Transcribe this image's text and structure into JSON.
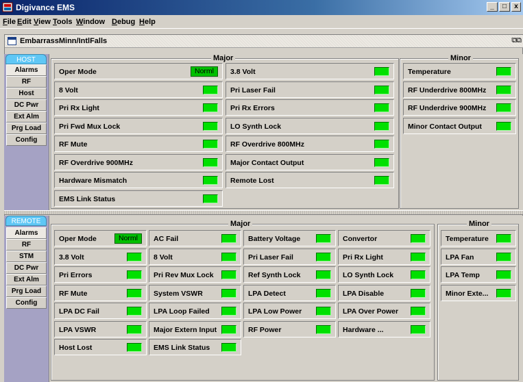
{
  "window": {
    "title": "Digivance EMS",
    "controls": {
      "minimize": "_",
      "maximize": "□",
      "close": "x"
    }
  },
  "menu": [
    "File",
    "Edit",
    "View",
    "Tools",
    "Window",
    "Debug",
    "Help"
  ],
  "document": {
    "title": "EmbarrassMinn/IntlFalls",
    "restore_glyph": "⧉⧉"
  },
  "host": {
    "side_label": "HOST",
    "tabs": [
      "Alarms",
      "RF",
      "Host",
      "DC Pwr",
      "Ext Alm",
      "Prg Load",
      "Config"
    ],
    "selected_tab": "Alarms",
    "major_label": "Major",
    "minor_label": "Minor",
    "major": [
      {
        "label": "Oper Mode",
        "mode": "Norml"
      },
      {
        "label": "3.8 Volt",
        "status": "ok"
      },
      {
        "label": "8 Volt",
        "status": "ok"
      },
      {
        "label": "Pri Laser Fail",
        "status": "ok"
      },
      {
        "label": "Pri Rx Light",
        "status": "ok"
      },
      {
        "label": "Pri Rx Errors",
        "status": "ok"
      },
      {
        "label": "Pri Fwd Mux Lock",
        "status": "ok"
      },
      {
        "label": "LO Synth Lock",
        "status": "ok"
      },
      {
        "label": "RF Mute",
        "status": "ok"
      },
      {
        "label": "RF Overdrive 800MHz",
        "status": "ok"
      },
      {
        "label": "RF Overdrive 900MHz",
        "status": "ok"
      },
      {
        "label": "Major Contact Output",
        "status": "ok"
      },
      {
        "label": "Hardware Mismatch",
        "status": "ok"
      },
      {
        "label": "Remote Lost",
        "status": "ok"
      },
      {
        "label": "EMS Link Status",
        "status": "ok"
      }
    ],
    "minor": [
      {
        "label": "Temperature",
        "status": "ok"
      },
      {
        "label": "RF Underdrive 800MHz",
        "status": "ok"
      },
      {
        "label": "RF Underdrive 900MHz",
        "status": "ok"
      },
      {
        "label": "Minor Contact Output",
        "status": "ok"
      }
    ]
  },
  "remote": {
    "side_label": "REMOTE",
    "tabs": [
      "Alarms",
      "RF",
      "STM",
      "DC Pwr",
      "Ext Alm",
      "Prg Load",
      "Config"
    ],
    "selected_tab": "Alarms",
    "major_label": "Major",
    "minor_label": "Minor",
    "major": [
      {
        "label": "Oper Mode",
        "mode": "Norml"
      },
      {
        "label": "AC Fail",
        "status": "ok"
      },
      {
        "label": "Battery Voltage",
        "status": "ok"
      },
      {
        "label": "Convertor",
        "status": "ok"
      },
      {
        "label": "3.8 Volt",
        "status": "ok"
      },
      {
        "label": "8 Volt",
        "status": "ok"
      },
      {
        "label": "Pri Laser Fail",
        "status": "ok"
      },
      {
        "label": "Pri Rx Light",
        "status": "ok"
      },
      {
        "label": "Pri Errors",
        "status": "ok"
      },
      {
        "label": "Pri Rev Mux Lock",
        "status": "ok"
      },
      {
        "label": "Ref Synth Lock",
        "status": "ok"
      },
      {
        "label": "LO Synth Lock",
        "status": "ok"
      },
      {
        "label": "RF Mute",
        "status": "ok"
      },
      {
        "label": "System VSWR",
        "status": "ok"
      },
      {
        "label": "LPA Detect",
        "status": "ok"
      },
      {
        "label": "LPA Disable",
        "status": "ok"
      },
      {
        "label": "LPA DC Fail",
        "status": "ok"
      },
      {
        "label": "LPA Loop Failed",
        "status": "ok"
      },
      {
        "label": "LPA Low Power",
        "status": "ok"
      },
      {
        "label": "LPA Over Power",
        "status": "ok"
      },
      {
        "label": "LPA VSWR",
        "status": "ok"
      },
      {
        "label": "Major Extern Input",
        "status": "ok"
      },
      {
        "label": "RF Power",
        "status": "ok"
      },
      {
        "label": "Hardware ...",
        "status": "ok"
      },
      {
        "label": "Host Lost",
        "status": "ok"
      },
      {
        "label": "EMS Link Status",
        "status": "ok"
      }
    ],
    "minor": [
      {
        "label": "Temperature",
        "status": "ok"
      },
      {
        "label": "LPA Fan",
        "status": "ok"
      },
      {
        "label": "LPA Temp",
        "status": "ok"
      },
      {
        "label": "Minor Exte...",
        "status": "ok"
      }
    ]
  },
  "colors": {
    "led_ok": "#00e000",
    "mode_bg": "#00c000",
    "tab_strip": "#a5a2c4",
    "side_label": "#5fc7f5"
  }
}
